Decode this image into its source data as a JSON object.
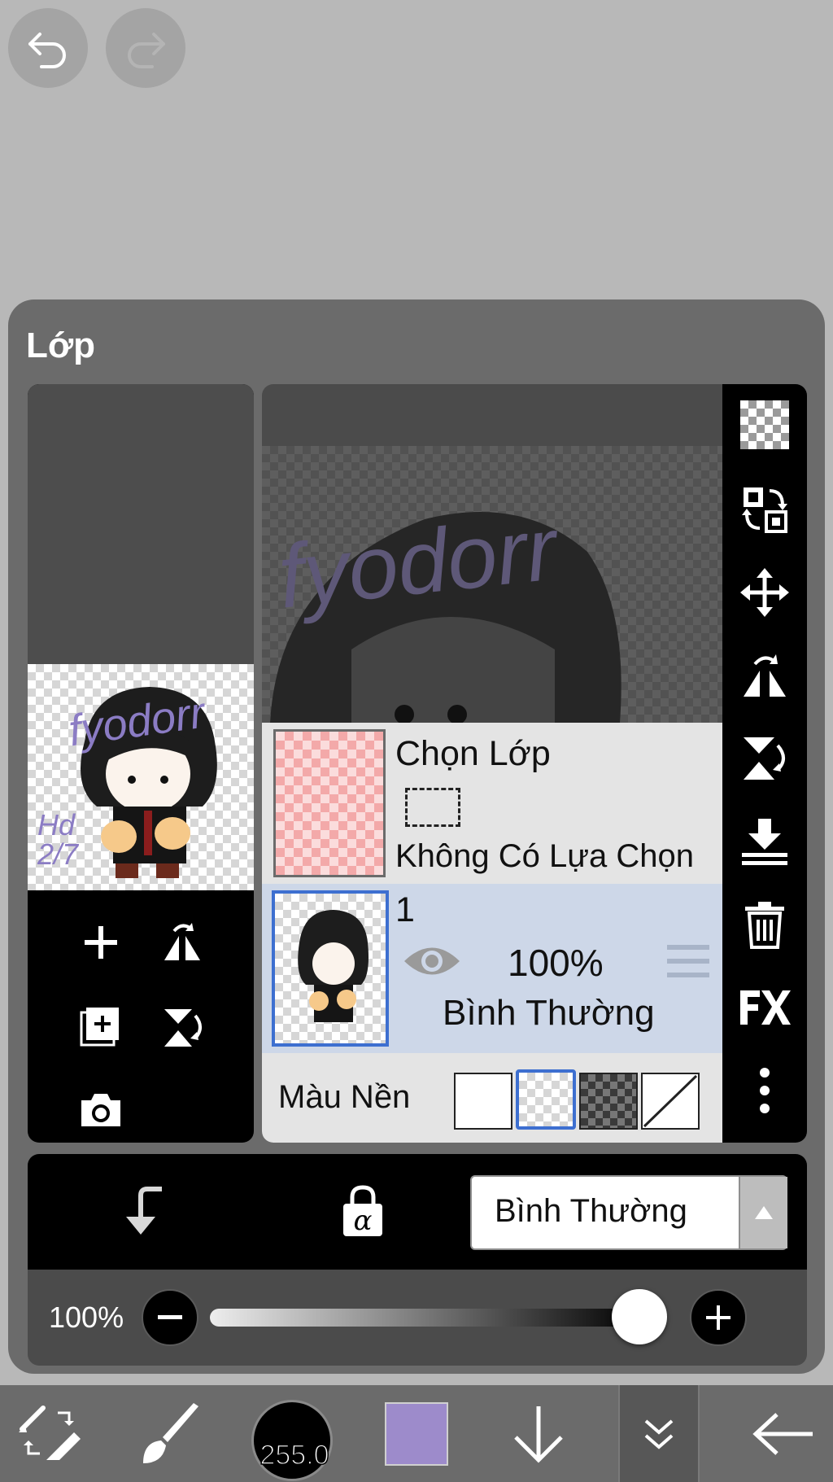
{
  "top_buttons": {
    "undo_icon": "undo-icon",
    "redo_icon": "redo-icon"
  },
  "panel": {
    "title": "Lớp"
  },
  "preview": {
    "watermark_text": "fyodorr",
    "signature_text": "Hd 2/7"
  },
  "selection_layer": {
    "title": "Chọn Lớp",
    "status": "Không Có Lựa Chọn"
  },
  "layer_1": {
    "name": "1",
    "opacity": "100%",
    "blend_mode": "Bình Thường"
  },
  "background": {
    "label": "Màu Nền",
    "options": [
      "white",
      "transparent",
      "dark-checker",
      "none"
    ],
    "selected_index": 1
  },
  "blend_dropdown": {
    "value": "Bình Thường"
  },
  "opacity_slider": {
    "value_text": "100%",
    "value": 1.0
  },
  "toolbar": {
    "brush_size": "255.0",
    "color": "#9d8bcb"
  },
  "colors": {
    "accent_blue": "#3d6fd0",
    "layer_selected_bg": "#cdd7e8"
  }
}
